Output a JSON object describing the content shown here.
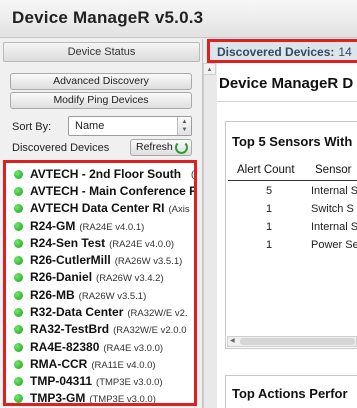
{
  "app": {
    "title": "Device ManageR  v5.0.3"
  },
  "sidebar": {
    "header": "Device Status",
    "advanced_discovery_label": "Advanced Discovery",
    "modify_ping_label": "Modify Ping Devices",
    "sort_by_label": "Sort By:",
    "sort_by_value": "Name",
    "discovered_label": "Discovered Devices",
    "refresh_label": "Refresh",
    "devices": [
      {
        "name": "AVTECH - 2nd Floor South",
        "model": "(A",
        "status": "online"
      },
      {
        "name": "AVTECH - Main Conference R",
        "model": "",
        "status": "online"
      },
      {
        "name": "AVTECH Data Center RI",
        "model": "(Axis",
        "status": "online"
      },
      {
        "name": "R24-GM",
        "model": "(RA24E v4.0.1)",
        "status": "online"
      },
      {
        "name": "R24-Sen Test",
        "model": "(RA24E v4.0.0)",
        "status": "online"
      },
      {
        "name": "R26-CutlerMill",
        "model": "(RA26W v3.5.1)",
        "status": "online"
      },
      {
        "name": "R26-Daniel",
        "model": "(RA26W v3.4.2)",
        "status": "online"
      },
      {
        "name": "R26-MB",
        "model": "(RA26W v3.5.1)",
        "status": "online"
      },
      {
        "name": "R32-Data Center",
        "model": "(RA32W/E v2.",
        "status": "online"
      },
      {
        "name": "RA32-TestBrd",
        "model": "(RA32W/E v2.0.0",
        "status": "online"
      },
      {
        "name": "RA4E-82380",
        "model": "(RA4E v3.0.0)",
        "status": "online"
      },
      {
        "name": "RMA-CCR",
        "model": "(RA11E v4.0.0)",
        "status": "online"
      },
      {
        "name": "TMP-04311",
        "model": "(TMP3E v3.0.0)",
        "status": "online"
      },
      {
        "name": "TMP3-GM",
        "model": "(TMP3E v3.0.0)",
        "status": "online"
      }
    ]
  },
  "discovered_bar": {
    "label": "Discovered Devices:",
    "count": "14"
  },
  "main": {
    "title": "Device ManageR D",
    "sensors_card": {
      "title": "Top 5 Sensors With",
      "columns": [
        "Alert Count",
        "Sensor"
      ],
      "rows": [
        {
          "count": "5",
          "sensor": "Internal S"
        },
        {
          "count": "1",
          "sensor": "Switch S"
        },
        {
          "count": "1",
          "sensor": "Internal S"
        },
        {
          "count": "1",
          "sensor": "Power Se"
        }
      ]
    },
    "actions_card": {
      "title": "Top Actions Perfor"
    }
  },
  "colors": {
    "highlight": "#e01f1f",
    "status_online": "#2fbf2a",
    "bar_bg": "#dde4ec"
  }
}
